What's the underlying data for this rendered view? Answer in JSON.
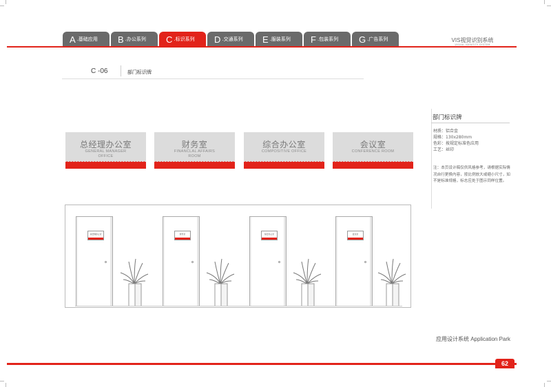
{
  "header": {
    "tabs": [
      {
        "letter": "A",
        "label": ".基础应用",
        "active": false
      },
      {
        "letter": "B",
        "label": ".办公系列",
        "active": false
      },
      {
        "letter": "C",
        "label": ".标识系列",
        "active": true
      },
      {
        "letter": "D",
        "label": ".交通系列",
        "active": false
      },
      {
        "letter": "E",
        "label": ".服装系列",
        "active": false
      },
      {
        "letter": "F",
        "label": ".包装系列",
        "active": false
      },
      {
        "letter": "G",
        "label": ".广告系列",
        "active": false
      }
    ],
    "vis_title": "VIS视觉识别系统",
    "vis_subtitle": "VISUAL IDENTITY SYSTEM"
  },
  "section": {
    "code": "C -06",
    "name": "部门标识牌"
  },
  "signs": [
    {
      "cn": "总经理办公室",
      "en1": "GENERAL MANAGER",
      "en2": "OFFICE"
    },
    {
      "cn": "财务室",
      "en1": "FINANCLAL AFFAIRS",
      "en2": "ROOM"
    },
    {
      "cn": "综合办公室",
      "en1": "COMPOSITIVE OFFICE",
      "en2": ""
    },
    {
      "cn": "会议室",
      "en1": "CONFERENCE ROOM",
      "en2": ""
    }
  ],
  "door_plates": [
    "总经理办公室",
    "财务室",
    "综合办公室",
    "会议室"
  ],
  "spec": {
    "title": "部门标识牌",
    "material": "材质：铝合金",
    "size": "规格：130x280mm",
    "color": "色彩：按规定标准色应用",
    "process": "工艺：丝印",
    "note": "注：本页设计稿仅供风格参考，请根据实际情况自行更换内容，按比例放大或缩小尺寸，如不是标准规格，标志应处于图示同样位置。"
  },
  "footer": {
    "category": "应用设计系统  Application Park",
    "page_number": "62"
  },
  "colors": {
    "accent": "#e2231a",
    "tab_gray": "#6a6a6a",
    "sign_gray": "#dcdcdc"
  }
}
